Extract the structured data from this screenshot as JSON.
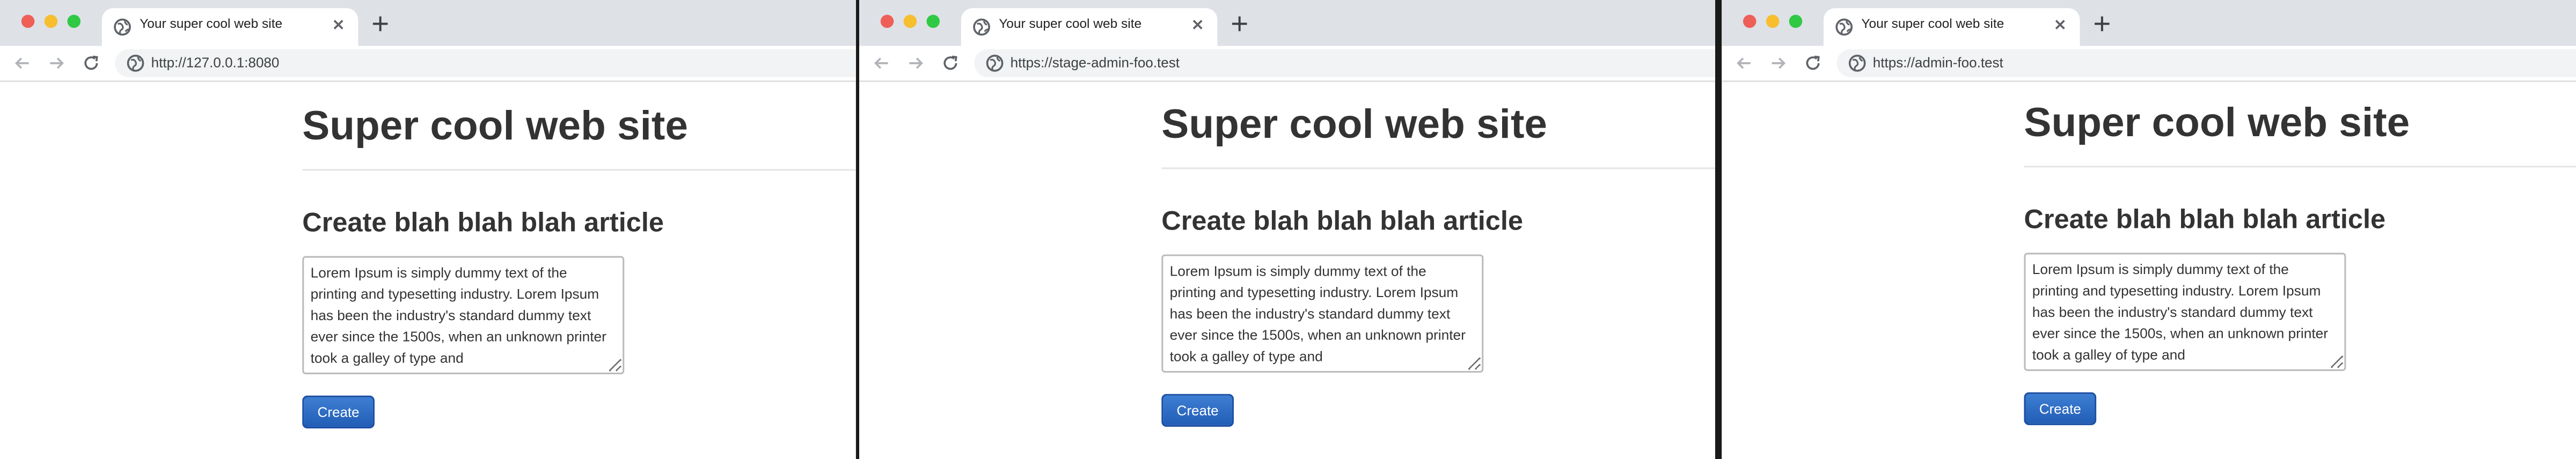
{
  "windows": [
    {
      "tab_title": "Your super cool web site",
      "url": "http://127.0.0.1:8080",
      "site_title": "Super cool web site",
      "heading": "Create blah blah blah article",
      "textarea_value": "Lorem Ipsum is simply dummy text of the printing and typesetting industry. Lorem Ipsum has been the industry's standard dummy text ever since the 1500s, when an unknown printer took a galley of type and",
      "button_label": "Create"
    },
    {
      "tab_title": "Your super cool web site",
      "url": "https://stage-admin-foo.test",
      "site_title": "Super cool web site",
      "heading": "Create blah blah blah article",
      "textarea_value": "Lorem Ipsum is simply dummy text of the printing and typesetting industry. Lorem Ipsum has been the industry's standard dummy text ever since the 1500s, when an unknown printer took a galley of type and",
      "button_label": "Create"
    },
    {
      "tab_title": "Your super cool web site",
      "url": "https://admin-foo.test",
      "site_title": "Super cool web site",
      "heading": "Create blah blah blah article",
      "textarea_value": "Lorem Ipsum is simply dummy text of the printing and typesetting industry. Lorem Ipsum has been the industry's standard dummy text ever since the 1500s, when an unknown printer took a galley of type and",
      "button_label": "Create"
    }
  ],
  "icons": {
    "tab": "globe-icon",
    "tab_close": "close-icon",
    "new_tab": "plus-icon",
    "back": "arrow-left-icon",
    "forward": "arrow-right-icon",
    "reload": "reload-icon",
    "site_info": "site-info-icon"
  },
  "colors": {
    "tabbar_bg": "#dee1e6",
    "close_light": "#ee5f58",
    "minimize_light": "#f7be2e",
    "maximize_light": "#2fc944",
    "button_bg": "#225db6",
    "text": "#333333"
  }
}
